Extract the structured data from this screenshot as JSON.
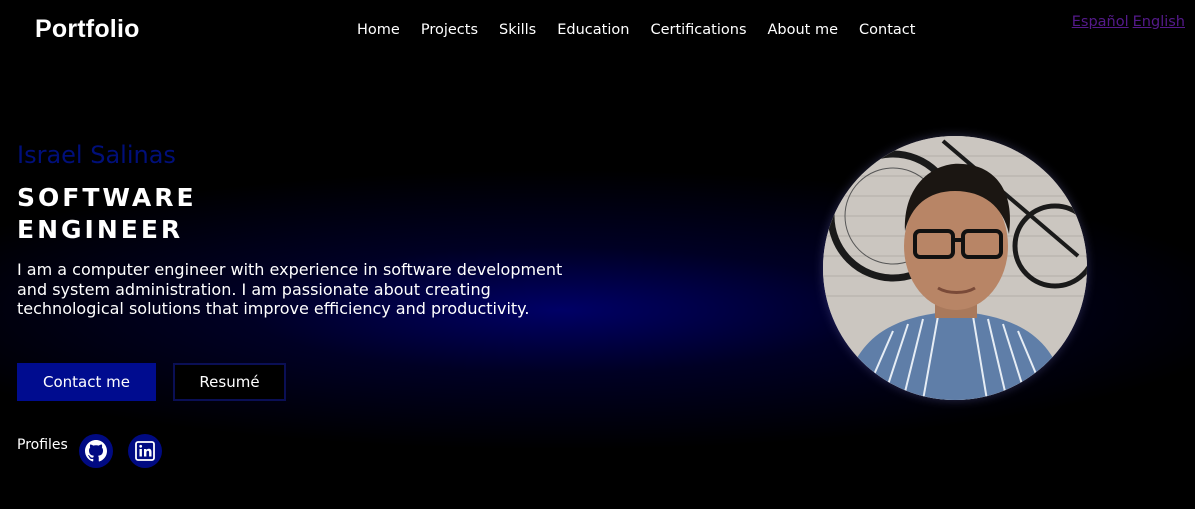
{
  "header": {
    "logo": "Portfolio",
    "nav": [
      "Home",
      "Projects",
      "Skills",
      "Education",
      "Certifications",
      "About me",
      "Contact"
    ],
    "languages": [
      "Español",
      "English"
    ]
  },
  "hero": {
    "name": "Israel Salinas",
    "role_line1": "SOFTWARE",
    "role_line2": "ENGINEER",
    "bio": "I am a computer engineer with experience in software development and system administration. I am passionate about creating technological solutions that improve efficiency and productivity.",
    "contact_button": "Contact me",
    "resume_button": "Resumé",
    "profiles_label": "Profiles",
    "profile_icons": [
      "github-icon",
      "linkedin-icon"
    ]
  },
  "colors": {
    "background": "#000000",
    "accent": "#000c8f",
    "name": "#000f7a",
    "lang_link": "#551a8b"
  }
}
